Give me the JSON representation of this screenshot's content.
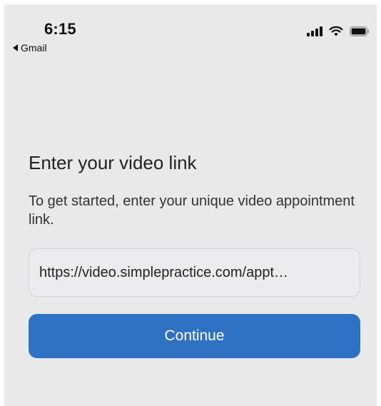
{
  "status_bar": {
    "time": "6:15",
    "back_app_label": "Gmail",
    "icons": [
      "signal-icon",
      "wifi-icon",
      "battery-icon"
    ]
  },
  "main": {
    "heading": "Enter your video link",
    "subtitle": "To get started, enter your unique video appointment link.",
    "link_input": {
      "value": "https://video.simplepractice.com/appt…"
    },
    "continue_label": "Continue"
  },
  "colors": {
    "background": "#e9e9ea",
    "primary_button": "#2f72c3",
    "button_text": "#ffffff"
  }
}
